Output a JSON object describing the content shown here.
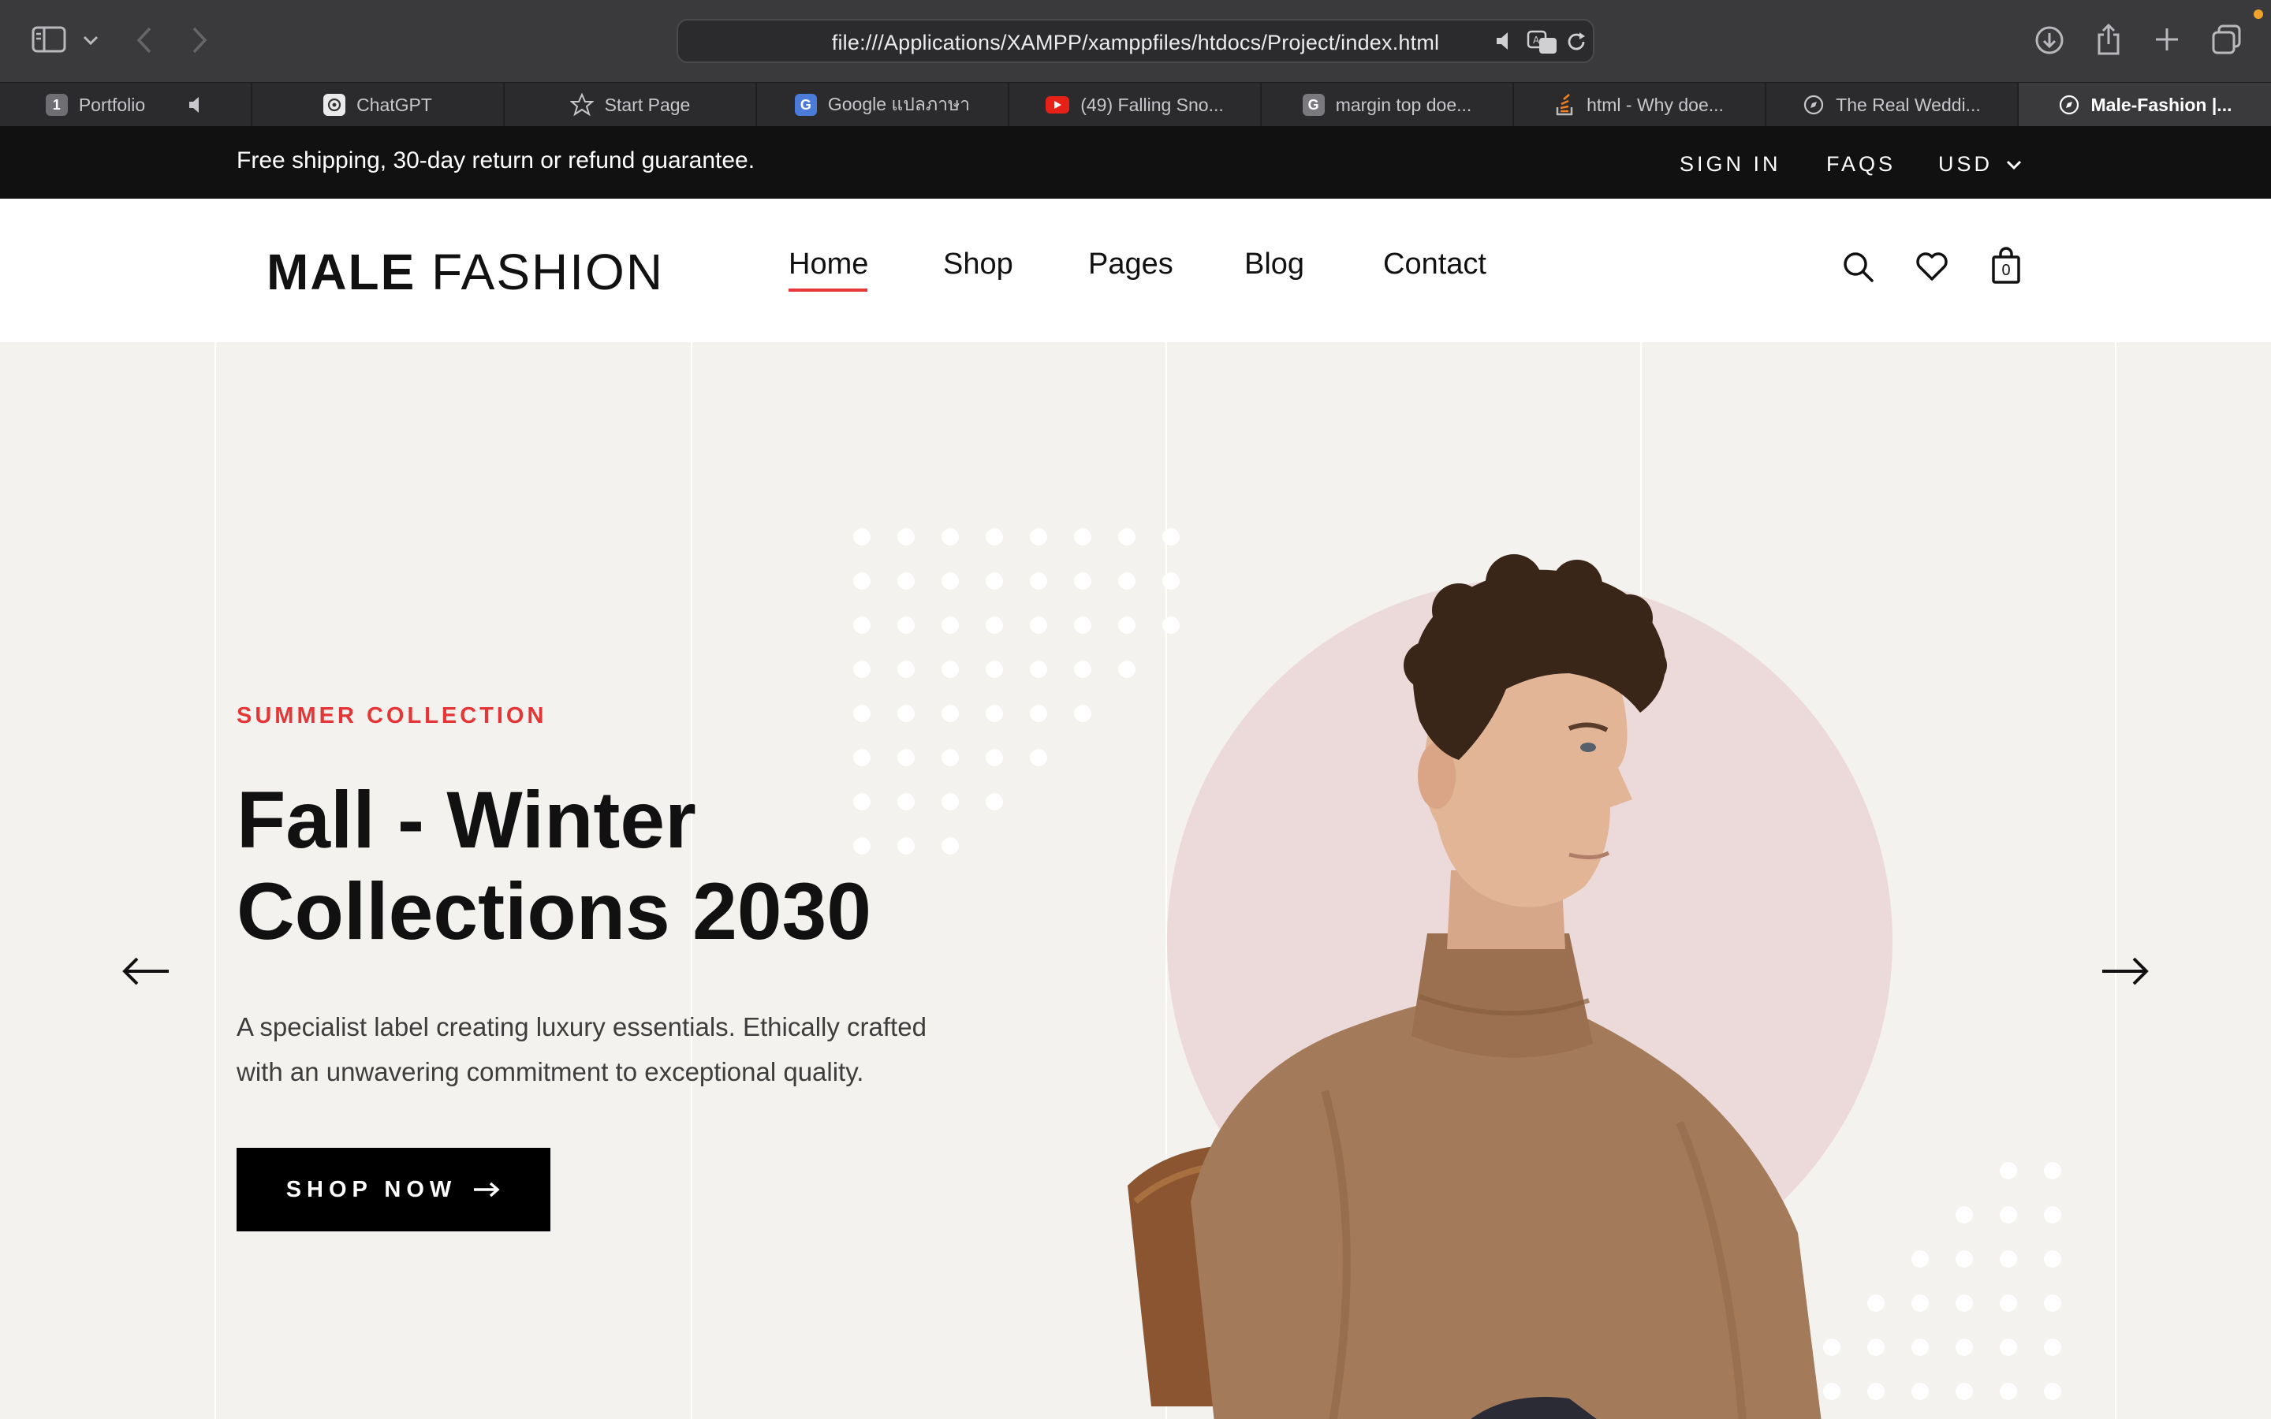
{
  "browser": {
    "url": "file:///Applications/XAMPP/xamppfiles/htdocs/Project/index.html",
    "tabs": [
      {
        "label": "Portfolio",
        "favicon_text": "1",
        "favicon_color": "#6e6e73"
      },
      {
        "label": "ChatGPT",
        "favicon_color": "#eaeaea"
      },
      {
        "label": "Start Page"
      },
      {
        "label": "Google แปลภาษา",
        "favicon_color": "#4a7bd8"
      },
      {
        "label": "(49) Falling Sno...",
        "favicon_color": "#e62117"
      },
      {
        "label": "margin top doe...",
        "favicon_text": "G",
        "favicon_color": "#7a7a7e"
      },
      {
        "label": "html - Why doe...",
        "favicon_color": "#f48024"
      },
      {
        "label": "The Real Weddi..."
      },
      {
        "label": "Male-Fashion |...",
        "active": true
      }
    ]
  },
  "site": {
    "accent_color": "#e53637",
    "topbar": {
      "message": "Free shipping, 30-day return or refund guarantee.",
      "sign_in": "SIGN IN",
      "faqs": "FAQS",
      "currency": "USD"
    },
    "logo": {
      "bold": "MALE",
      "light": " FASHION"
    },
    "nav": [
      "Home",
      "Shop",
      "Pages",
      "Blog",
      "Contact"
    ],
    "active_nav": "Home",
    "cart_count": "0",
    "hero": {
      "kicker": "SUMMER COLLECTION",
      "title_line1": "Fall - Winter",
      "title_line2": "Collections 2030",
      "description_line1": "A specialist label creating luxury essentials. Ethically crafted",
      "description_line2": "with an unwavering commitment to exceptional quality.",
      "cta": "SHOP NOW"
    }
  }
}
